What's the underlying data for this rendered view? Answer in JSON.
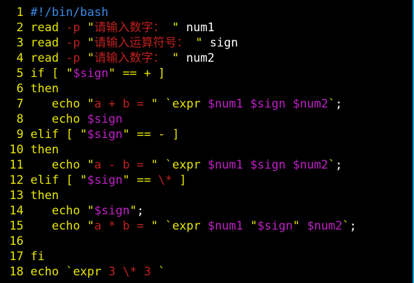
{
  "theme": {
    "background": "#000000",
    "line_number": "#e8e800",
    "comment": "#3a8ce8",
    "keyword": "#e8e800",
    "default": "#ffffff",
    "string": "#e8e800",
    "variable": "#c020c8",
    "option": "#c02020",
    "operator": "#c02020",
    "escape": "#c020c8",
    "cjk": "#c02020",
    "scrollbar": "#00a8e8"
  },
  "editor": {
    "lines": [
      {
        "num": "1",
        "tokens": [
          {
            "t": "#!/bin/bash",
            "c": "comment"
          }
        ]
      },
      {
        "num": "2",
        "tokens": [
          {
            "t": "read",
            "c": "keyword"
          },
          {
            "t": " ",
            "c": "default"
          },
          {
            "t": "-p",
            "c": "option"
          },
          {
            "t": " ",
            "c": "default"
          },
          {
            "t": "\"",
            "c": "string"
          },
          {
            "t": "请输入数字：",
            "c": "cjk"
          },
          {
            "t": " \"",
            "c": "string"
          },
          {
            "t": " num1",
            "c": "default"
          }
        ]
      },
      {
        "num": "3",
        "tokens": [
          {
            "t": "read",
            "c": "keyword"
          },
          {
            "t": " ",
            "c": "default"
          },
          {
            "t": "-p",
            "c": "option"
          },
          {
            "t": " ",
            "c": "default"
          },
          {
            "t": "\"",
            "c": "string"
          },
          {
            "t": "请输入运算符号：",
            "c": "cjk"
          },
          {
            "t": " \"",
            "c": "string"
          },
          {
            "t": " sign",
            "c": "default"
          }
        ]
      },
      {
        "num": "4",
        "tokens": [
          {
            "t": "read",
            "c": "keyword"
          },
          {
            "t": " ",
            "c": "default"
          },
          {
            "t": "-p",
            "c": "option"
          },
          {
            "t": " ",
            "c": "default"
          },
          {
            "t": "\"",
            "c": "string"
          },
          {
            "t": "请输入数字：",
            "c": "cjk"
          },
          {
            "t": " \"",
            "c": "string"
          },
          {
            "t": " num2",
            "c": "default"
          }
        ]
      },
      {
        "num": "5",
        "tokens": [
          {
            "t": "if",
            "c": "keyword"
          },
          {
            "t": " [ ",
            "c": "keyword"
          },
          {
            "t": "\"",
            "c": "string"
          },
          {
            "t": "$sign",
            "c": "variable"
          },
          {
            "t": "\"",
            "c": "string"
          },
          {
            "t": " == + ]",
            "c": "keyword"
          }
        ]
      },
      {
        "num": "6",
        "tokens": [
          {
            "t": "then",
            "c": "keyword"
          }
        ]
      },
      {
        "num": "7",
        "tokens": [
          {
            "t": "   echo ",
            "c": "keyword"
          },
          {
            "t": "\"",
            "c": "string"
          },
          {
            "t": "a + b = ",
            "c": "option"
          },
          {
            "t": "\"",
            "c": "string"
          },
          {
            "t": " `",
            "c": "string"
          },
          {
            "t": "expr ",
            "c": "string"
          },
          {
            "t": "$num1",
            "c": "variable"
          },
          {
            "t": " ",
            "c": "default"
          },
          {
            "t": "$sign",
            "c": "variable"
          },
          {
            "t": " ",
            "c": "default"
          },
          {
            "t": "$num2",
            "c": "variable"
          },
          {
            "t": "`",
            "c": "string"
          },
          {
            "t": ";",
            "c": "default"
          }
        ]
      },
      {
        "num": "8",
        "tokens": [
          {
            "t": "   echo ",
            "c": "keyword"
          },
          {
            "t": "$sign",
            "c": "variable"
          }
        ]
      },
      {
        "num": "9",
        "tokens": [
          {
            "t": "elif",
            "c": "keyword"
          },
          {
            "t": " [ ",
            "c": "keyword"
          },
          {
            "t": "\"",
            "c": "string"
          },
          {
            "t": "$sign",
            "c": "variable"
          },
          {
            "t": "\"",
            "c": "string"
          },
          {
            "t": " == - ]",
            "c": "keyword"
          }
        ]
      },
      {
        "num": "10",
        "tokens": [
          {
            "t": "then",
            "c": "keyword"
          }
        ]
      },
      {
        "num": "11",
        "tokens": [
          {
            "t": "   echo ",
            "c": "keyword"
          },
          {
            "t": "\"",
            "c": "string"
          },
          {
            "t": "a - b = ",
            "c": "option"
          },
          {
            "t": "\"",
            "c": "string"
          },
          {
            "t": " `",
            "c": "string"
          },
          {
            "t": "expr ",
            "c": "string"
          },
          {
            "t": "$num1",
            "c": "variable"
          },
          {
            "t": " ",
            "c": "default"
          },
          {
            "t": "$sign",
            "c": "variable"
          },
          {
            "t": " ",
            "c": "default"
          },
          {
            "t": "$num2",
            "c": "variable"
          },
          {
            "t": "`",
            "c": "string"
          },
          {
            "t": ";",
            "c": "default"
          }
        ]
      },
      {
        "num": "12",
        "tokens": [
          {
            "t": "elif",
            "c": "keyword"
          },
          {
            "t": " [ ",
            "c": "keyword"
          },
          {
            "t": "\"",
            "c": "string"
          },
          {
            "t": "$sign",
            "c": "variable"
          },
          {
            "t": "\"",
            "c": "string"
          },
          {
            "t": " == ",
            "c": "keyword"
          },
          {
            "t": "\\*",
            "c": "option"
          },
          {
            "t": " ]",
            "c": "keyword"
          }
        ]
      },
      {
        "num": "13",
        "tokens": [
          {
            "t": "then",
            "c": "keyword"
          }
        ]
      },
      {
        "num": "14",
        "tokens": [
          {
            "t": "   echo ",
            "c": "keyword"
          },
          {
            "t": "\"",
            "c": "string"
          },
          {
            "t": "$sign",
            "c": "variable"
          },
          {
            "t": "\"",
            "c": "string"
          },
          {
            "t": ";",
            "c": "default"
          }
        ]
      },
      {
        "num": "15",
        "tokens": [
          {
            "t": "   echo ",
            "c": "keyword"
          },
          {
            "t": "\"",
            "c": "string"
          },
          {
            "t": "a * b = ",
            "c": "option"
          },
          {
            "t": "\"",
            "c": "string"
          },
          {
            "t": " `",
            "c": "string"
          },
          {
            "t": "expr ",
            "c": "string"
          },
          {
            "t": "$num1",
            "c": "variable"
          },
          {
            "t": " ",
            "c": "default"
          },
          {
            "t": "\"",
            "c": "string"
          },
          {
            "t": "$sign",
            "c": "variable"
          },
          {
            "t": "\"",
            "c": "string"
          },
          {
            "t": " ",
            "c": "default"
          },
          {
            "t": "$num2",
            "c": "variable"
          },
          {
            "t": "`",
            "c": "string"
          },
          {
            "t": ";",
            "c": "default"
          }
        ]
      },
      {
        "num": "16",
        "tokens": []
      },
      {
        "num": "17",
        "tokens": [
          {
            "t": "fi",
            "c": "keyword"
          }
        ]
      },
      {
        "num": "18",
        "tokens": [
          {
            "t": "echo ",
            "c": "keyword"
          },
          {
            "t": "`",
            "c": "string"
          },
          {
            "t": "expr ",
            "c": "string"
          },
          {
            "t": "3",
            "c": "option"
          },
          {
            "t": " ",
            "c": "default"
          },
          {
            "t": "\\*",
            "c": "option"
          },
          {
            "t": " ",
            "c": "default"
          },
          {
            "t": "3",
            "c": "option"
          },
          {
            "t": " `",
            "c": "string"
          }
        ]
      }
    ]
  }
}
